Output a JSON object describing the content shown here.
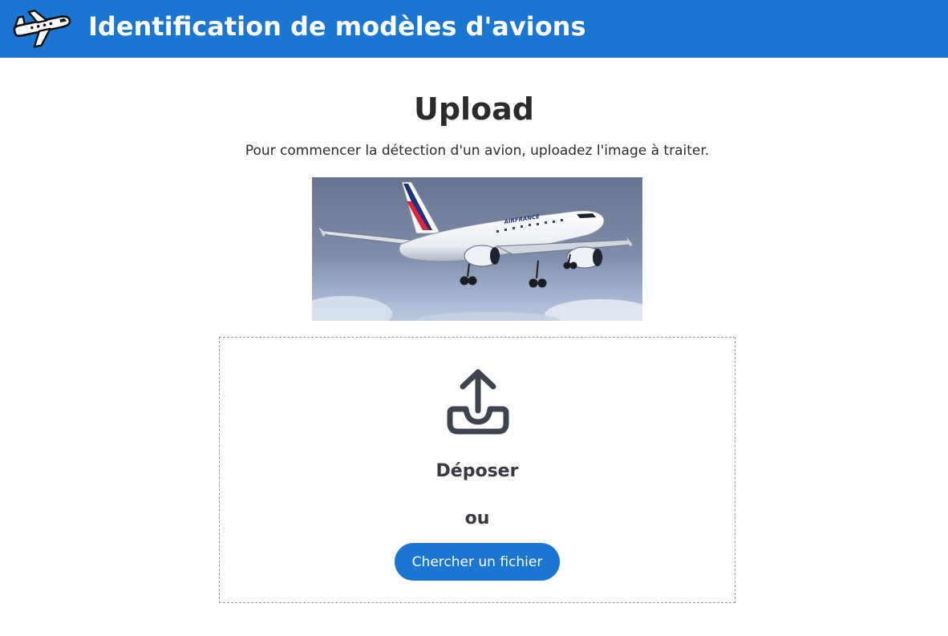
{
  "header": {
    "logo_icon": "airplane-icon",
    "title": "Identification de modèles d'avions",
    "background_color": "#1b76d2"
  },
  "main": {
    "title": "Upload",
    "subtitle": "Pour commencer la détection d'un avion, uploadez l'image à traiter."
  },
  "preview": {
    "description": "uploaded-airplane-photo",
    "livery_text": "AIRFRANCE"
  },
  "dropzone": {
    "icon": "upload-icon",
    "drop_label": "Déposer",
    "or_label": "ou",
    "browse_label": "Chercher un fichier",
    "accent_color": "#1b76d2"
  }
}
